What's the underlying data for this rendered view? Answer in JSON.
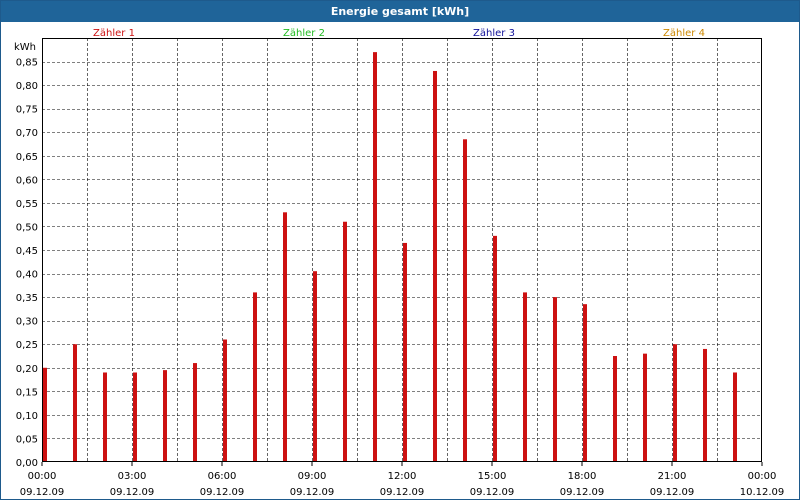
{
  "window": {
    "title": "Energie gesamt [kWh]"
  },
  "legend": [
    {
      "label": "Zähler 1",
      "color": "#cc1111"
    },
    {
      "label": "Zähler 2",
      "color": "#22bb22"
    },
    {
      "label": "Zähler 3",
      "color": "#111199"
    },
    {
      "label": "Zähler 4",
      "color": "#cc8800"
    }
  ],
  "chart_data": {
    "type": "bar",
    "ylabel": "kWh",
    "ylim": [
      0,
      0.9
    ],
    "y_ticks": [
      "0,00",
      "0,05",
      "0,10",
      "0,15",
      "0,20",
      "0,25",
      "0,30",
      "0,35",
      "0,40",
      "0,45",
      "0,50",
      "0,55",
      "0,60",
      "0,65",
      "0,70",
      "0,75",
      "0,80",
      "0,85"
    ],
    "x_range_hours": [
      0,
      24
    ],
    "x_ticks": [
      {
        "time": "00:00",
        "date": "09.12.09"
      },
      {
        "time": "03:00",
        "date": "09.12.09"
      },
      {
        "time": "06:00",
        "date": "09.12.09"
      },
      {
        "time": "09:00",
        "date": "09.12.09"
      },
      {
        "time": "12:00",
        "date": "09.12.09"
      },
      {
        "time": "15:00",
        "date": "09.12.09"
      },
      {
        "time": "18:00",
        "date": "09.12.09"
      },
      {
        "time": "21:00",
        "date": "09.12.09"
      },
      {
        "time": "00:00",
        "date": "10.12.09"
      }
    ],
    "grid": true,
    "series": [
      {
        "name": "Zähler 1",
        "color": "#cc1111",
        "x_hours": [
          0,
          1,
          2,
          3,
          4,
          5,
          6,
          7,
          8,
          9,
          10,
          11,
          12,
          13,
          14,
          15,
          16,
          17,
          18,
          19,
          20,
          21,
          22,
          23
        ],
        "values": [
          0.2,
          0.25,
          0.19,
          0.19,
          0.195,
          0.21,
          0.26,
          0.36,
          0.53,
          0.405,
          0.51,
          0.87,
          0.465,
          0.83,
          0.685,
          0.48,
          0.36,
          0.35,
          0.335,
          0.225,
          0.23,
          0.25,
          0.24,
          0.19
        ]
      }
    ]
  }
}
